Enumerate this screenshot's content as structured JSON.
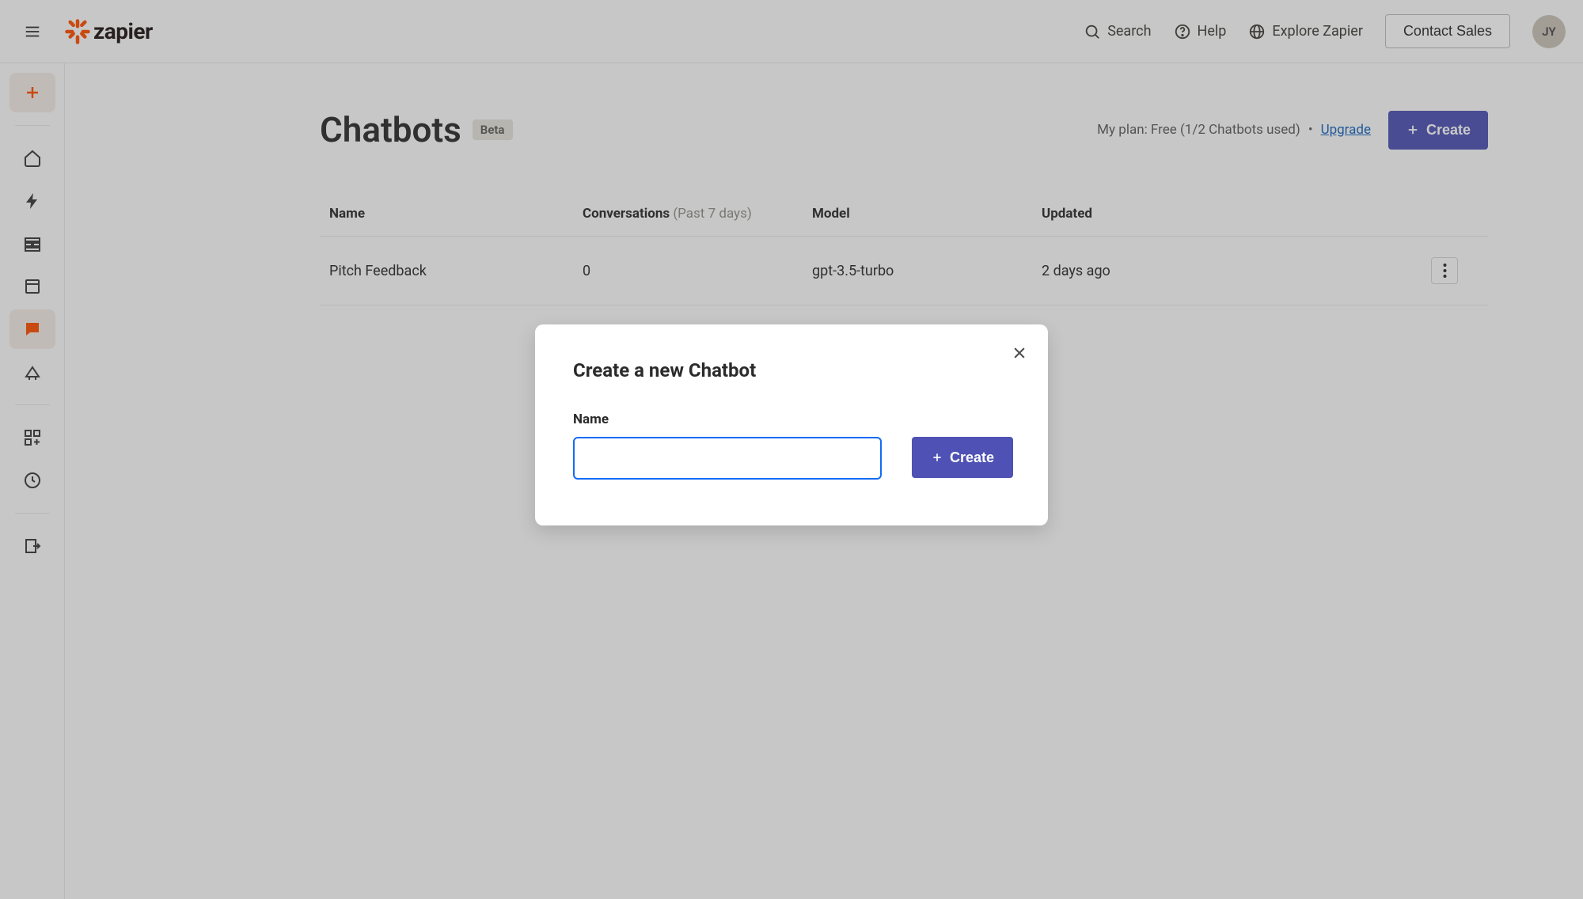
{
  "header": {
    "search": "Search",
    "help": "Help",
    "explore": "Explore Zapier",
    "contact_sales": "Contact Sales",
    "avatar_initials": "JY",
    "logo_text": "zapier"
  },
  "page": {
    "title": "Chatbots",
    "beta_label": "Beta",
    "plan_text": "My plan: Free (1/2 Chatbots used)",
    "upgrade_label": "Upgrade",
    "create_label": "Create"
  },
  "table": {
    "columns": {
      "name": "Name",
      "conversations": "Conversations",
      "conversations_sub": "(Past 7 days)",
      "model": "Model",
      "updated": "Updated"
    },
    "rows": [
      {
        "name": "Pitch Feedback",
        "conversations": "0",
        "model": "gpt-3.5-turbo",
        "updated": "2 days ago"
      }
    ]
  },
  "modal": {
    "title": "Create a new Chatbot",
    "name_label": "Name",
    "name_value": "",
    "create_label": "Create"
  }
}
